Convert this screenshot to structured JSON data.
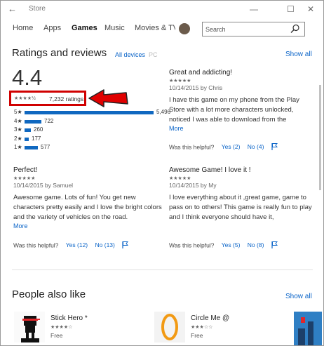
{
  "window": {
    "back_glyph": "←",
    "title": "Store",
    "minimize_glyph": "—",
    "maximize_glyph": "☐",
    "close_glyph": "✕"
  },
  "nav": {
    "tabs": [
      "Home",
      "Apps",
      "Games",
      "Music",
      "Movies & TV"
    ],
    "active_tab": "Games",
    "search_placeholder": "Search",
    "search_icon": "search-icon"
  },
  "ratings": {
    "heading": "Ratings and reviews",
    "device_filter_active": "All devices",
    "device_filter_other": "PC",
    "show_all": "Show all",
    "average": "4.4",
    "average_stars": "★★★★½",
    "total_label": "7,232 ratings",
    "highlight_color": "#d00000",
    "bar_color": "#1068c0",
    "histogram": [
      {
        "label": "5★",
        "count": "5,496",
        "value": 5496
      },
      {
        "label": "4★",
        "count": "722",
        "value": 722
      },
      {
        "label": "3★",
        "count": "260",
        "value": 260
      },
      {
        "label": "2★",
        "count": "177",
        "value": 177
      },
      {
        "label": "1★",
        "count": "577",
        "value": 577
      }
    ]
  },
  "reviews": [
    {
      "title": "Great and addicting!",
      "stars": "★★★★★",
      "meta": "10/14/2015 by Chris",
      "body": "I have this game on my phone from the Play Store with a lot more characters unlocked, noticed I was able to download from the",
      "more": "More",
      "helpful_q": "Was this helpful?",
      "yes": "Yes (2)",
      "no": "No (4)"
    },
    {
      "title": "Perfect!",
      "stars": "★★★★★",
      "meta": "10/14/2015 by Samuel",
      "body": "Awesome game. Lots of fun! You get new characters pretty easily and I love the bright colors and the variety of vehicles on the road.",
      "more": "More",
      "helpful_q": "Was this helpful?",
      "yes": "Yes (12)",
      "no": "No (13)"
    },
    {
      "title": "Awesome Game! I love it !",
      "stars": "★★★★★",
      "meta": "10/14/2015 by My",
      "body": "I love everything about it ,great game, game to pass on to others! This game is really fun to play and I think everyone should have it,",
      "more": "",
      "helpful_q": "Was this helpful?",
      "yes": "Yes (5)",
      "no": "No (8)"
    }
  ],
  "people_also_like": {
    "heading": "People also like",
    "show_all": "Show all",
    "items": [
      {
        "name": "Stick Hero *",
        "stars": "★★★★☆",
        "price": "Free"
      },
      {
        "name": "Circle Me @",
        "stars": "★★★☆☆",
        "price": "Free"
      }
    ]
  }
}
